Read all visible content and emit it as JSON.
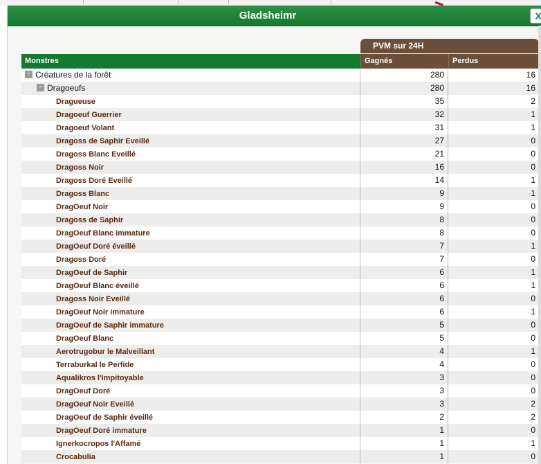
{
  "dialog": {
    "title": "Gladsheimr",
    "close_label": "X"
  },
  "table": {
    "pvm_header": "PVM sur 24H",
    "columns": {
      "monstres": "Monstres",
      "gagnes": "Gagnés",
      "perdus": "Perdus"
    },
    "category": {
      "label": "Créatures de la forêt",
      "gagnes": "280",
      "perdus": "16"
    },
    "group": {
      "label": "Dragoeufs",
      "gagnes": "280",
      "perdus": "16"
    },
    "monsters": [
      {
        "name": "Dragueuse",
        "gagnes": "35",
        "perdus": "2"
      },
      {
        "name": "Dragoeuf Guerrier",
        "gagnes": "32",
        "perdus": "1"
      },
      {
        "name": "Dragoeuf Volant",
        "gagnes": "31",
        "perdus": "1"
      },
      {
        "name": "Dragoss de Saphir Eveillé",
        "gagnes": "27",
        "perdus": "0"
      },
      {
        "name": "Dragoss Blanc Eveillé",
        "gagnes": "21",
        "perdus": "0"
      },
      {
        "name": "Dragoss Noir",
        "gagnes": "16",
        "perdus": "0"
      },
      {
        "name": "Dragoss Doré Eveillé",
        "gagnes": "14",
        "perdus": "1"
      },
      {
        "name": "Dragoss Blanc",
        "gagnes": "9",
        "perdus": "1"
      },
      {
        "name": "DragOeuf Noir",
        "gagnes": "9",
        "perdus": "0"
      },
      {
        "name": "Dragoss de Saphir",
        "gagnes": "8",
        "perdus": "0"
      },
      {
        "name": "DragOeuf Blanc immature",
        "gagnes": "8",
        "perdus": "0"
      },
      {
        "name": "DragOeuf Doré éveillé",
        "gagnes": "7",
        "perdus": "1"
      },
      {
        "name": "Dragoss Doré",
        "gagnes": "7",
        "perdus": "0"
      },
      {
        "name": "DragOeuf de Saphir",
        "gagnes": "6",
        "perdus": "1"
      },
      {
        "name": "DragOeuf Blanc éveillé",
        "gagnes": "6",
        "perdus": "1"
      },
      {
        "name": "Dragoss Noir Eveillé",
        "gagnes": "6",
        "perdus": "0"
      },
      {
        "name": "DragOeuf Noir immature",
        "gagnes": "6",
        "perdus": "1"
      },
      {
        "name": "DragOeuf de Saphir immature",
        "gagnes": "5",
        "perdus": "0"
      },
      {
        "name": "DragOeuf Blanc",
        "gagnes": "5",
        "perdus": "0"
      },
      {
        "name": "Aerotrugobur le Malveillant",
        "gagnes": "4",
        "perdus": "1"
      },
      {
        "name": "Terraburkal le Perfide",
        "gagnes": "4",
        "perdus": "0"
      },
      {
        "name": "Aqualikros l'Impitoyable",
        "gagnes": "3",
        "perdus": "0"
      },
      {
        "name": "DragOeuf Doré",
        "gagnes": "3",
        "perdus": "0"
      },
      {
        "name": "DragOeuf Noir Eveillé",
        "gagnes": "3",
        "perdus": "2"
      },
      {
        "name": "DragOeuf de Saphir éveillé",
        "gagnes": "2",
        "perdus": "2"
      },
      {
        "name": "DragOeuf Doré immature",
        "gagnes": "1",
        "perdus": "0"
      },
      {
        "name": "Ignerkocropos l'Affamé",
        "gagnes": "1",
        "perdus": "1"
      },
      {
        "name": "Crocabulia",
        "gagnes": "1",
        "perdus": "0"
      }
    ]
  },
  "colors": {
    "title_green": "#157a2e",
    "header_brown": "#6b4f3a",
    "monster_text": "#5a2a14"
  }
}
